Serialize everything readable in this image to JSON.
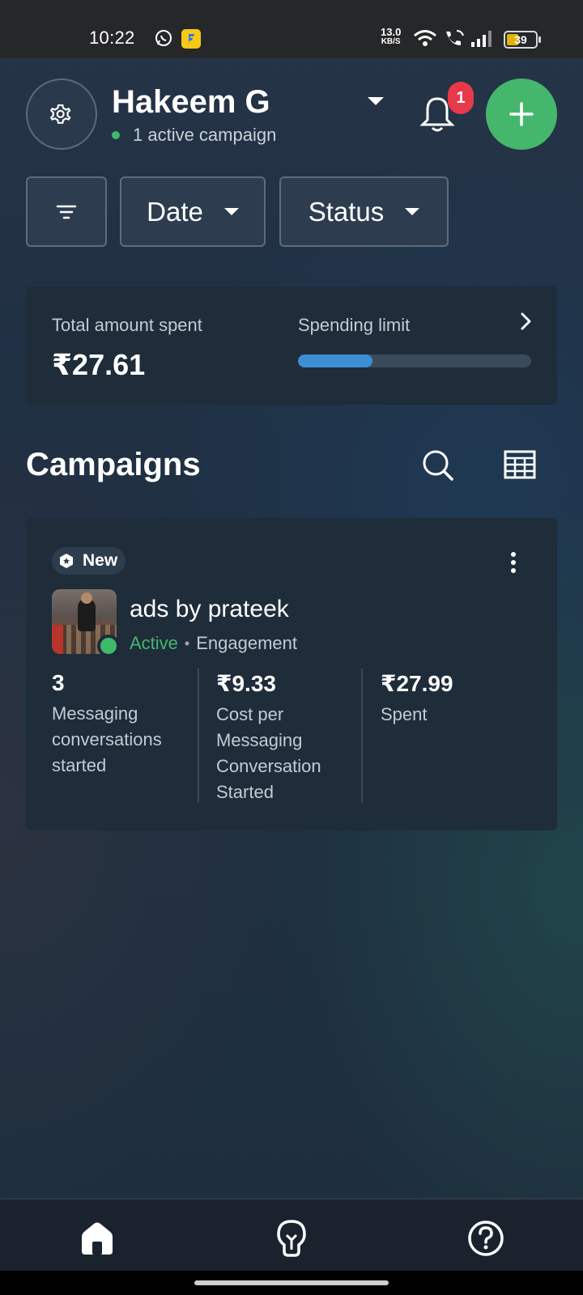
{
  "status_bar": {
    "time": "10:22",
    "net_speed": "13.0",
    "net_unit": "KB/S",
    "battery": "39"
  },
  "header": {
    "account_name": "Hakeem G",
    "subtitle": "1 active campaign",
    "notification_count": "1"
  },
  "filters": {
    "date_label": "Date",
    "status_label": "Status"
  },
  "spend": {
    "total_label": "Total amount spent",
    "total_value": "₹27.61",
    "limit_label": "Spending limit",
    "limit_progress": 0.32
  },
  "campaigns": {
    "title": "Campaigns",
    "items": [
      {
        "badge": "New",
        "name": "ads by prateek",
        "status": "Active",
        "objective": "Engagement",
        "metrics": [
          {
            "value": "3",
            "label": "Messaging conversations started"
          },
          {
            "value": "₹9.33",
            "label": "Cost per Messaging Conversation Started"
          },
          {
            "value": "₹27.99",
            "label": "Spent"
          }
        ]
      }
    ]
  },
  "colors": {
    "accent_green": "#45b76c",
    "badge_red": "#e8394a",
    "progress_blue": "#3c8fd3",
    "status_active": "#44b76b"
  },
  "icons": {
    "settings": "gear-icon",
    "notifications": "bell-icon",
    "create": "plus-icon",
    "filter": "filter-icon",
    "search": "search-icon",
    "table": "table-icon",
    "more": "more-vertical-icon",
    "home": "home-icon",
    "tips": "lightbulb-icon",
    "help": "help-icon"
  }
}
